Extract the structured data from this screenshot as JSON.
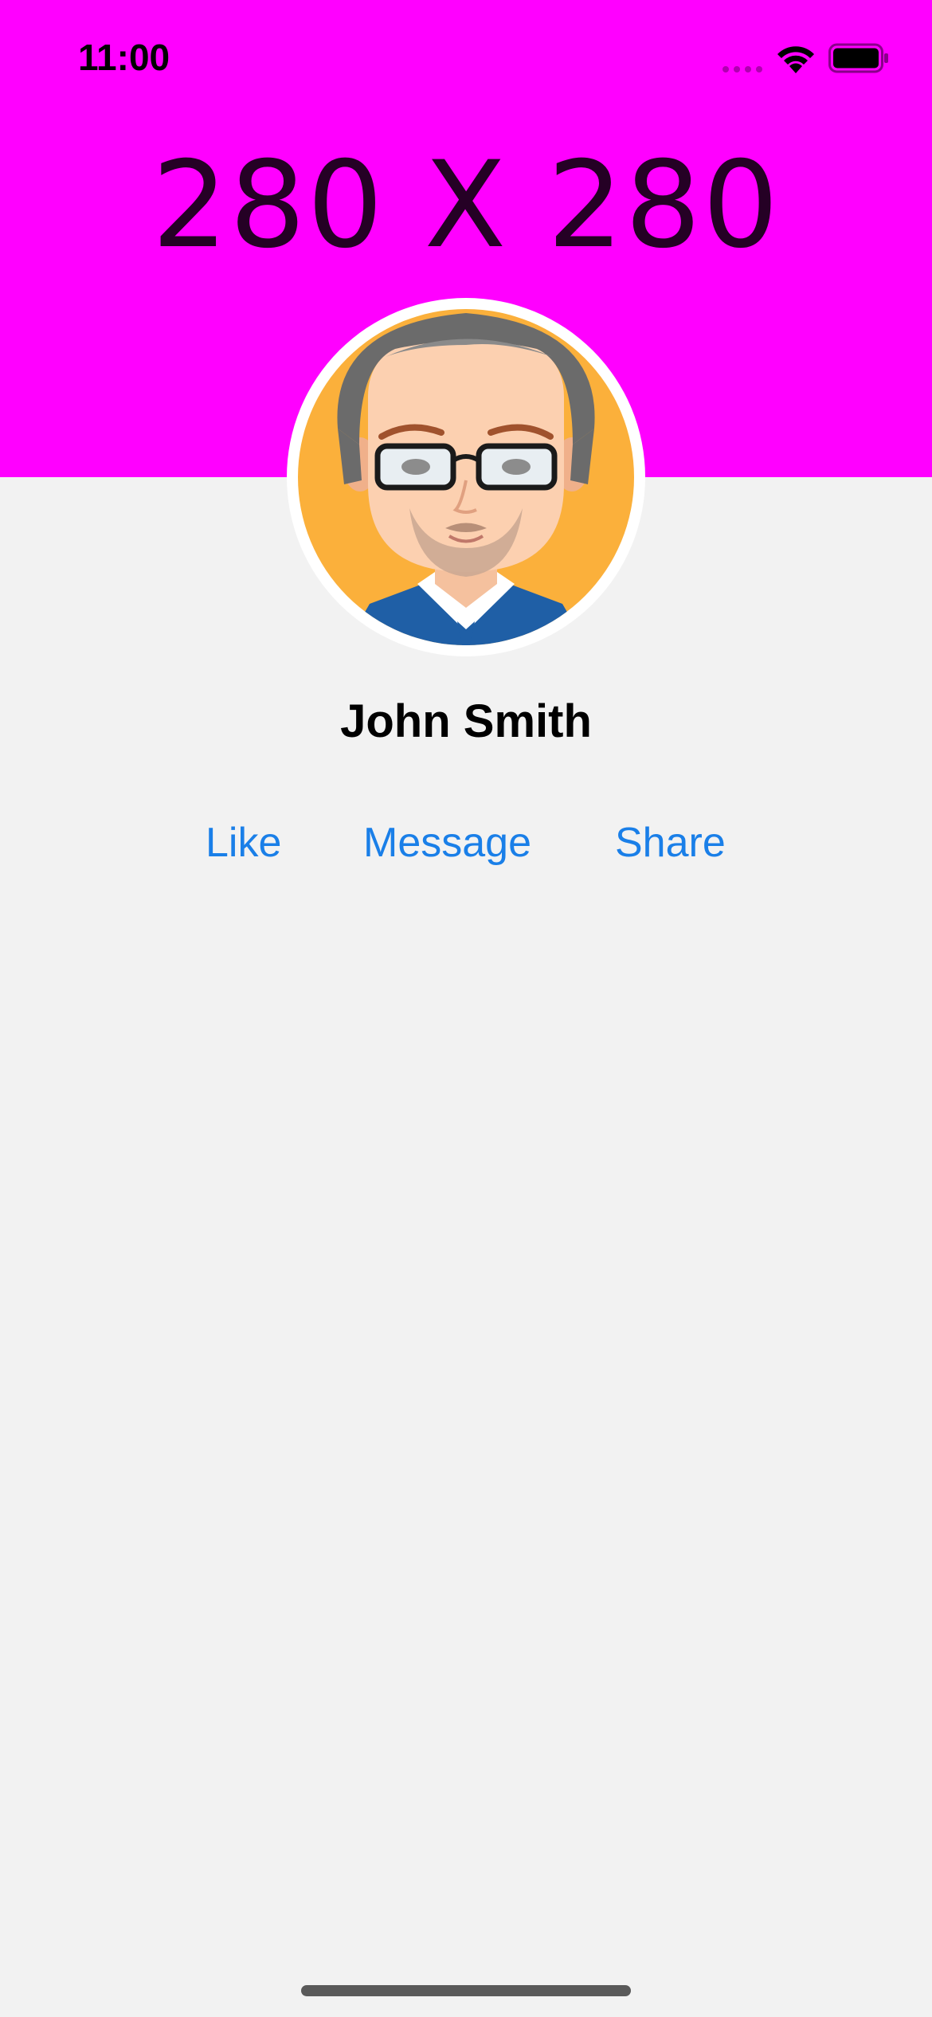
{
  "status_bar": {
    "time": "11:00"
  },
  "banner": {
    "text": "280 X 280",
    "color": "#ff00ff"
  },
  "profile": {
    "name": "John Smith",
    "avatar_icon": "person-avatar-icon"
  },
  "actions": [
    {
      "label": "Like"
    },
    {
      "label": "Message"
    },
    {
      "label": "Share"
    }
  ],
  "colors": {
    "accent": "#1a7fe8",
    "background": "#f2f2f2"
  }
}
